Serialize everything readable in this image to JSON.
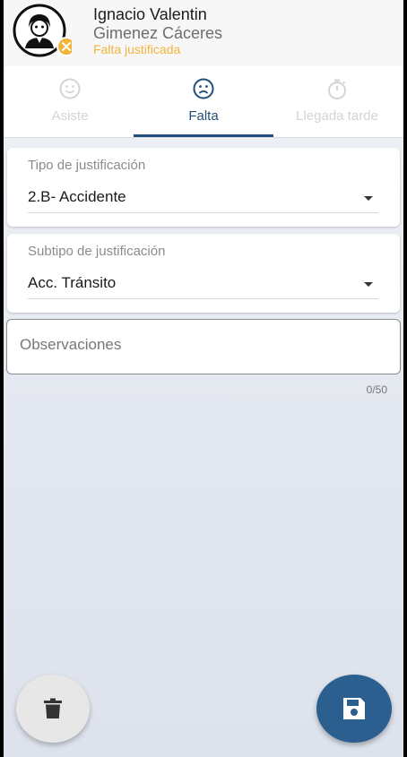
{
  "student": {
    "first_name": "Ignacio Valentin",
    "last_name": "Gimenez Cáceres",
    "status": "Falta justificada"
  },
  "tabs": [
    {
      "label": "Asiste",
      "icon": "smile-icon",
      "state": "disabled"
    },
    {
      "label": "Falta",
      "icon": "sad-face-icon",
      "state": "active"
    },
    {
      "label": "Llegada tarde",
      "icon": "stopwatch-icon",
      "state": "disabled"
    }
  ],
  "form": {
    "justification_type": {
      "label": "Tipo de justificación",
      "value": "2.B- Accidente"
    },
    "justification_subtype": {
      "label": "Subtipo de justificación",
      "value": "Acc. Tránsito"
    },
    "observations": {
      "placeholder": "Observaciones",
      "value": "",
      "counter": "0/50"
    }
  },
  "actions": {
    "delete_icon": "trash-icon",
    "save_icon": "floppy-disk-icon"
  },
  "colors": {
    "accent": "#1f4f7a",
    "status": "#f2b53c",
    "save_fab": "#2a5f8f",
    "delete_fab": "#e7e7e7"
  }
}
